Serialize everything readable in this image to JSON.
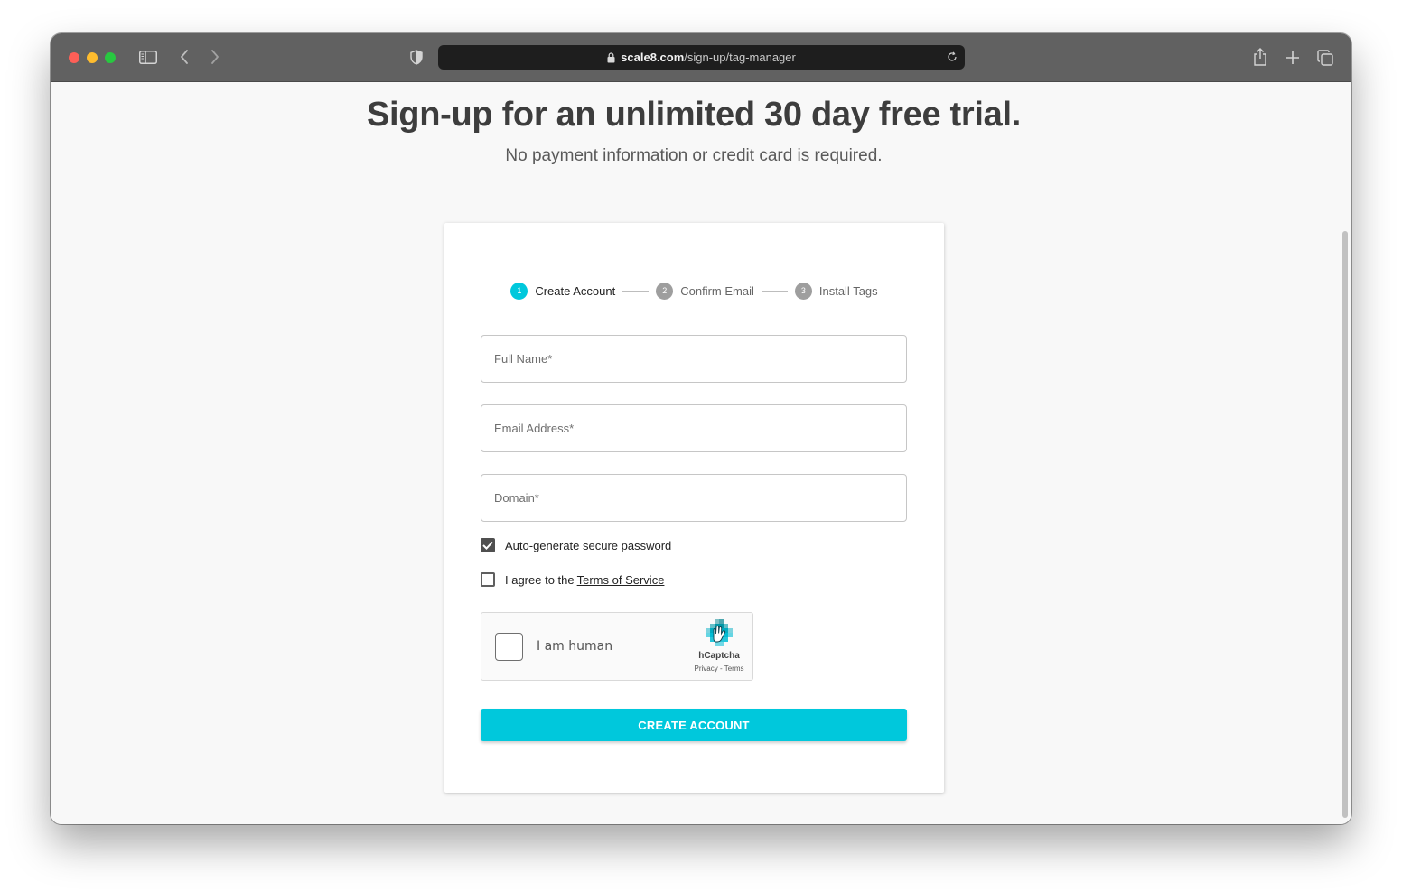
{
  "browser": {
    "url_domain": "scale8.com",
    "url_path": "/sign-up/tag-manager"
  },
  "page": {
    "headline": "Sign-up for an unlimited 30 day free trial.",
    "subline": "No payment information or credit card is required."
  },
  "stepper": {
    "steps": [
      {
        "number": "1",
        "label": "Create Account",
        "active": true
      },
      {
        "number": "2",
        "label": "Confirm Email",
        "active": false
      },
      {
        "number": "3",
        "label": "Install Tags",
        "active": false
      }
    ]
  },
  "form": {
    "full_name": {
      "placeholder": "Full Name*",
      "value": ""
    },
    "email": {
      "placeholder": "Email Address*",
      "value": ""
    },
    "domain": {
      "placeholder": "Domain*",
      "value": ""
    },
    "auto_password": {
      "label": "Auto-generate secure password",
      "checked": true
    },
    "terms": {
      "label_prefix": "I agree to the",
      "link_text": "Terms of Service",
      "checked": false
    },
    "submit_label": "CREATE ACCOUNT"
  },
  "captcha": {
    "label": "I am human",
    "brand": "hCaptcha",
    "links": "Privacy - Terms",
    "checked": false
  },
  "colors": {
    "accent": "#00c8dc",
    "titlebar": "#616161",
    "page_bg": "#f8f8f8"
  }
}
